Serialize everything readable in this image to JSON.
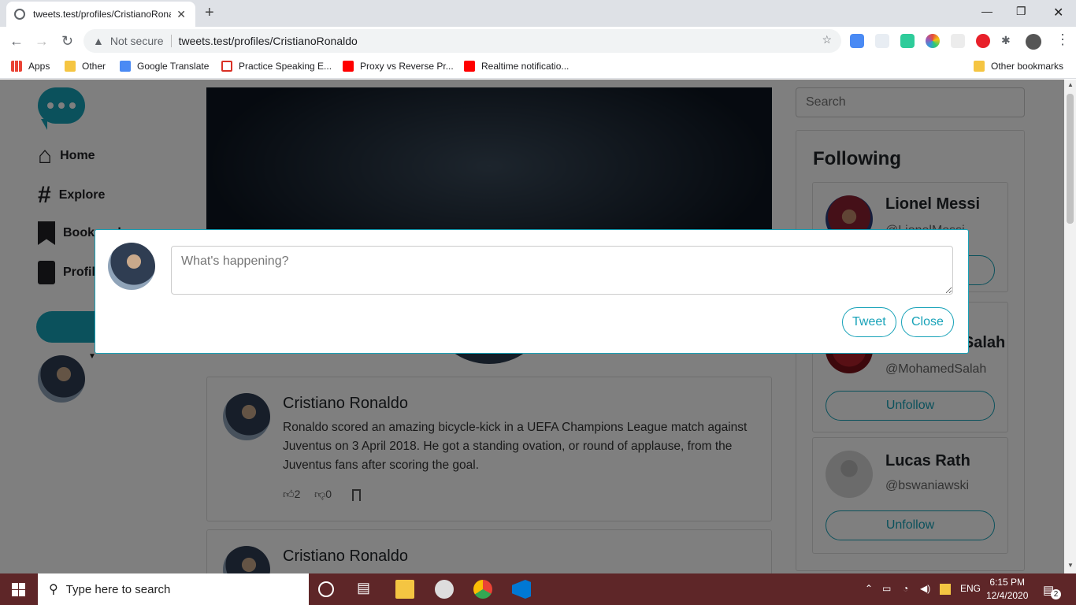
{
  "browser": {
    "tab_title": "tweets.test/profiles/CristianoRonaldo",
    "url_warning": "Not secure",
    "url": "tweets.test/profiles/CristianoRonaldo",
    "bookmarks": [
      "Apps",
      "Other",
      "Google Translate",
      "Practice Speaking E...",
      "Proxy vs Reverse Pr...",
      "Realtime notificatio..."
    ],
    "other_bookmarks": "Other bookmarks"
  },
  "sidebar": {
    "items": [
      {
        "label": "Home",
        "icon": "home-icon"
      },
      {
        "label": "Explore",
        "icon": "hash-icon"
      },
      {
        "label": "Bookmarks",
        "icon": "bookmark-icon"
      },
      {
        "label": "Profile",
        "icon": "profile-icon"
      }
    ]
  },
  "tweets": [
    {
      "name": "Cristiano Ronaldo",
      "text": "Ronaldo scored an amazing bicycle-kick in a UEFA Champions League match against Juventus on 3 April 2018. He got a standing ovation, or round of applause, from the Juventus fans after scoring the goal.",
      "likes": "2",
      "dislikes": "0"
    },
    {
      "name": "Cristiano Ronaldo"
    }
  ],
  "right": {
    "search_placeholder": "Search",
    "following_title": "Following",
    "following": [
      {
        "name": "Lionel Messi",
        "handle": "@LionelMessi",
        "button": "Unfollow"
      },
      {
        "name": "Mohamed Salah",
        "handle": "@MohamedSalah",
        "button": "Unfollow"
      },
      {
        "name": "Lucas Rath",
        "handle": "@bswaniawski",
        "button": "Unfollow"
      }
    ]
  },
  "modal": {
    "placeholder": "What's happening?",
    "tweet_button": "Tweet",
    "close_button": "Close"
  },
  "taskbar": {
    "search_placeholder": "Type here to search",
    "lang": "ENG",
    "time": "6:15 PM",
    "date": "12/4/2020",
    "notifications": "2"
  },
  "colors": {
    "accent": "#17a2b8",
    "taskbar": "#5e2628"
  }
}
